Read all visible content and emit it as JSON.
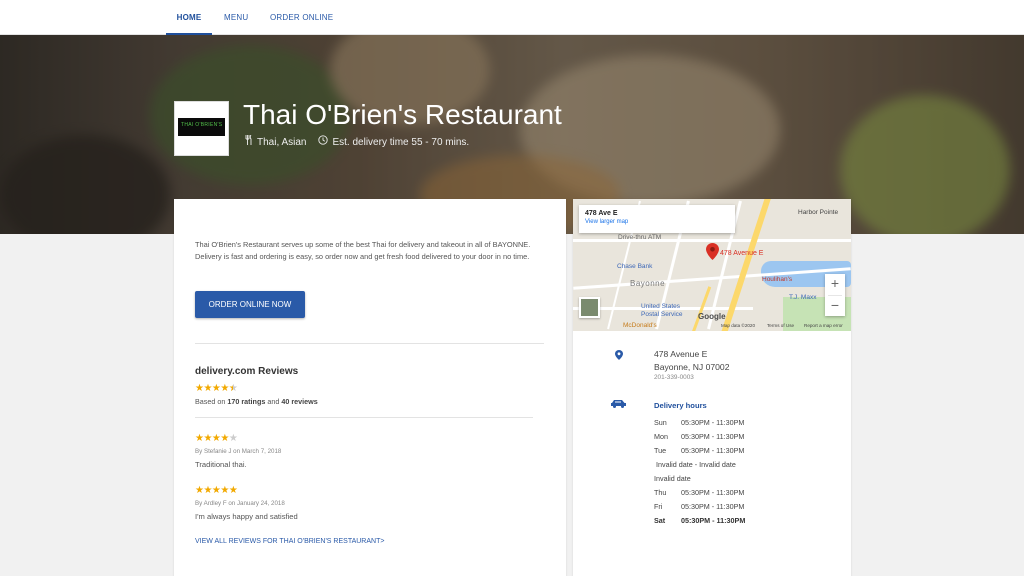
{
  "nav": {
    "tabs": [
      {
        "label": "HOME",
        "active": true
      },
      {
        "label": "MENU",
        "active": false
      },
      {
        "label": "ORDER ONLINE",
        "active": false
      }
    ]
  },
  "hero": {
    "logo_text": "THAI O'BRIEN'S",
    "title": "Thai O'Brien's Restaurant",
    "cuisine": "Thai, Asian",
    "delivery_estimate": "Est. delivery time 55 - 70 mins."
  },
  "about": {
    "text": "Thai O'Brien's Restaurant serves up some of the best Thai for delivery and takeout in all of BAYONNE. Delivery is fast and ordering is easy, so order now and get fresh food delivered to your door in no time.",
    "order_button": "ORDER ONLINE NOW"
  },
  "reviews": {
    "heading": "delivery.com Reviews",
    "overall_rating": 4.5,
    "based_prefix": "Based on",
    "ratings_count": "170 ratings",
    "and": "and",
    "reviews_count": "40 reviews",
    "items": [
      {
        "rating": 4,
        "by": "By Stefanie J on March 7, 2018",
        "text": "Traditional thai."
      },
      {
        "rating": 5,
        "by": "By Ardley F on January 24, 2018",
        "text": "I'm always happy and satisfied"
      }
    ],
    "view_all": "VIEW ALL REVIEWS FOR THAI O'BRIEN'S RESTAURANT>"
  },
  "map": {
    "box_address": "478 Ave E",
    "larger_map": "View larger map",
    "pin_label": "478 Avenue E",
    "labels": {
      "harbor": "Harbor Pointe",
      "drive": "Drive-thru ATM",
      "chase": "Chase Bank",
      "bayonne": "Bayonne",
      "houlihans": "Houlihan's",
      "tjmaxx": "T.J. Maxx",
      "usps1": "United States",
      "usps2": "Postal Service",
      "mcd": "McDonald's"
    },
    "google": "Google",
    "map_data": "Map data ©2020",
    "terms": "Terms of Use",
    "report": "Report a map error",
    "zoom_in": "+",
    "zoom_out": "−"
  },
  "location": {
    "street": "478 Avenue E",
    "city": "Bayonne, NJ 07002",
    "phone": "201-339-0003"
  },
  "hours": {
    "title": "Delivery hours",
    "rows": [
      {
        "day": "Sun",
        "time": "05:30PM - 11:30PM"
      },
      {
        "day": "Mon",
        "time": "05:30PM - 11:30PM"
      },
      {
        "day": "Tue",
        "time": "05:30PM - 11:30PM"
      },
      {
        "day": "",
        "time": "Invalid date - Invalid date"
      },
      {
        "day": "Invalid date",
        "time": ""
      },
      {
        "day": "Thu",
        "time": "05:30PM - 11:30PM"
      },
      {
        "day": "Fri",
        "time": "05:30PM - 11:30PM"
      },
      {
        "day": "Sat",
        "time": "05:30PM - 11:30PM"
      }
    ]
  },
  "colors": {
    "brand_blue": "#2a5aa8",
    "star": "#f2a900",
    "pin_red": "#d93025"
  }
}
